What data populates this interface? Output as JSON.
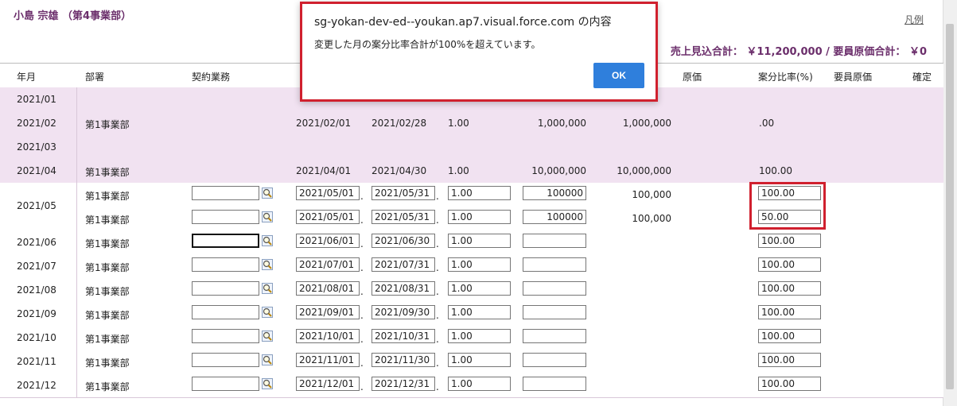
{
  "header": {
    "owner": "小島 宗雄 （第4事業部）",
    "legend_link": "凡例",
    "totals": "売上見込合計： ￥11,200,000 / 要員原価合計： ￥0"
  },
  "table": {
    "columns": {
      "ym": "年月",
      "dept": "部署",
      "contract": "契約業務",
      "cost": "原価",
      "ratio": "案分比率(%)",
      "staff_cost": "要員原価",
      "confirm": "確定"
    },
    "rows": [
      {
        "ym": "2021/01"
      },
      {
        "ym": "2021/02",
        "dept": "第1事業部",
        "start": "2021/02/01",
        "end": "2021/02/28",
        "qty": "1.00",
        "amount": "1,000,000",
        "cost": "1,000,000",
        "ratio": ".00"
      },
      {
        "ym": "2021/03"
      },
      {
        "ym": "2021/04",
        "dept": "第1事業部",
        "start": "2021/04/01",
        "end": "2021/04/30",
        "qty": "1.00",
        "amount": "10,000,000",
        "cost": "10,000,000",
        "ratio": "100.00"
      },
      {
        "ym": "2021/05",
        "dept": "第1事業部",
        "start": "2021/05/01",
        "end": "2021/05/31",
        "qty": "1.00",
        "amount": "100000",
        "cost": "100,000",
        "ratio": "100.00"
      },
      {
        "dept": "第1事業部",
        "start": "2021/05/01",
        "end": "2021/05/31",
        "qty": "1.00",
        "amount": "100000",
        "cost": "100,000",
        "ratio": "50.00"
      },
      {
        "ym": "2021/06",
        "dept": "第1事業部",
        "start": "2021/06/01",
        "end": "2021/06/30",
        "qty": "1.00",
        "ratio": "100.00"
      },
      {
        "ym": "2021/07",
        "dept": "第1事業部",
        "start": "2021/07/01",
        "end": "2021/07/31",
        "qty": "1.00",
        "ratio": "100.00"
      },
      {
        "ym": "2021/08",
        "dept": "第1事業部",
        "start": "2021/08/01",
        "end": "2021/08/31",
        "qty": "1.00",
        "ratio": "100.00"
      },
      {
        "ym": "2021/09",
        "dept": "第1事業部",
        "start": "2021/09/01",
        "end": "2021/09/30",
        "qty": "1.00",
        "ratio": "100.00"
      },
      {
        "ym": "2021/10",
        "dept": "第1事業部",
        "start": "2021/10/01",
        "end": "2021/10/31",
        "qty": "1.00",
        "ratio": "100.00"
      },
      {
        "ym": "2021/11",
        "dept": "第1事業部",
        "start": "2021/11/01",
        "end": "2021/11/30",
        "qty": "1.00",
        "ratio": "100.00"
      },
      {
        "ym": "2021/12",
        "dept": "第1事業部",
        "start": "2021/12/01",
        "end": "2021/12/31",
        "qty": "1.00",
        "ratio": "100.00"
      }
    ]
  },
  "dialog": {
    "title": "sg-yokan-dev-ed--youkan.ap7.visual.force.com の内容",
    "message": "変更した月の案分比率合計が100%を超えています。",
    "ok_label": "OK"
  },
  "colors": {
    "accent_purple": "#6b2e6b",
    "row_pink": "#f1e2f1",
    "highlight_red": "#d0202e",
    "ok_blue": "#2f7fdc"
  }
}
